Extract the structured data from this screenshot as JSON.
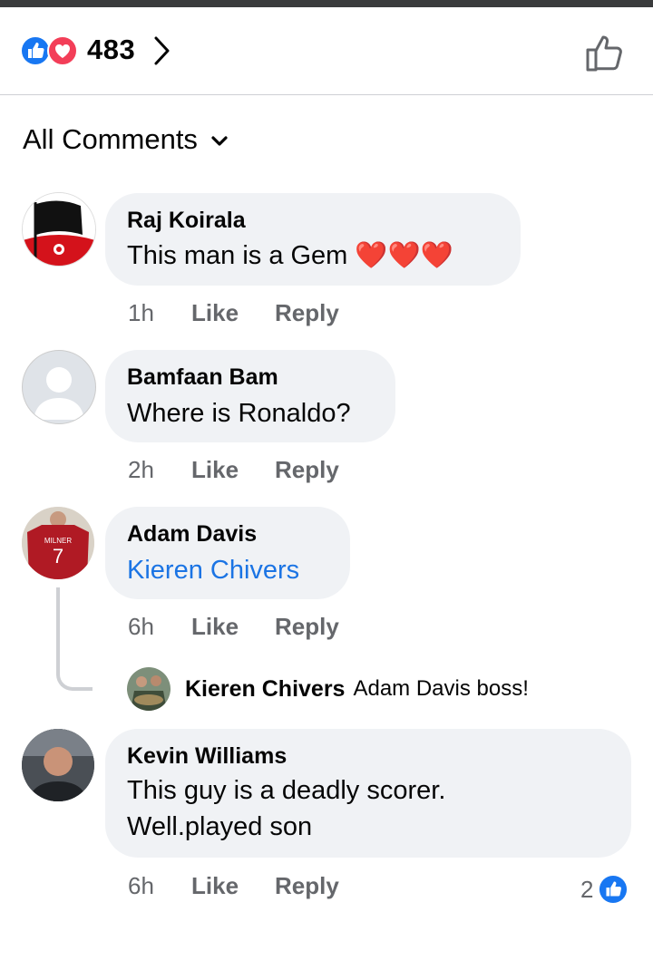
{
  "header": {
    "reaction_count": "483",
    "reaction_icons": [
      "like-icon",
      "love-icon"
    ],
    "like_color": "#1877f2",
    "love_color": "#f33e58"
  },
  "filter": {
    "label": "All Comments"
  },
  "comments": [
    {
      "author": "Raj Koirala",
      "text": "This man is a Gem",
      "emoji": "❤️❤️❤️",
      "time": "1h",
      "like": "Like",
      "reply": "Reply"
    },
    {
      "author": "Bamfaan Bam",
      "text": "Where is Ronaldo?",
      "time": "2h",
      "like": "Like",
      "reply": "Reply"
    },
    {
      "author": "Adam Davis",
      "text": "Kieren Chivers",
      "time": "6h",
      "like": "Like",
      "reply": "Reply",
      "reply_preview": {
        "author": "Kieren Chivers",
        "text": "Adam Davis boss!"
      }
    },
    {
      "author": "Kevin Williams",
      "text_line1": "This guy is a deadly scorer.",
      "text_line2": "Well.played son",
      "time": "6h",
      "like": "Like",
      "reply": "Reply",
      "like_count": "2"
    }
  ]
}
